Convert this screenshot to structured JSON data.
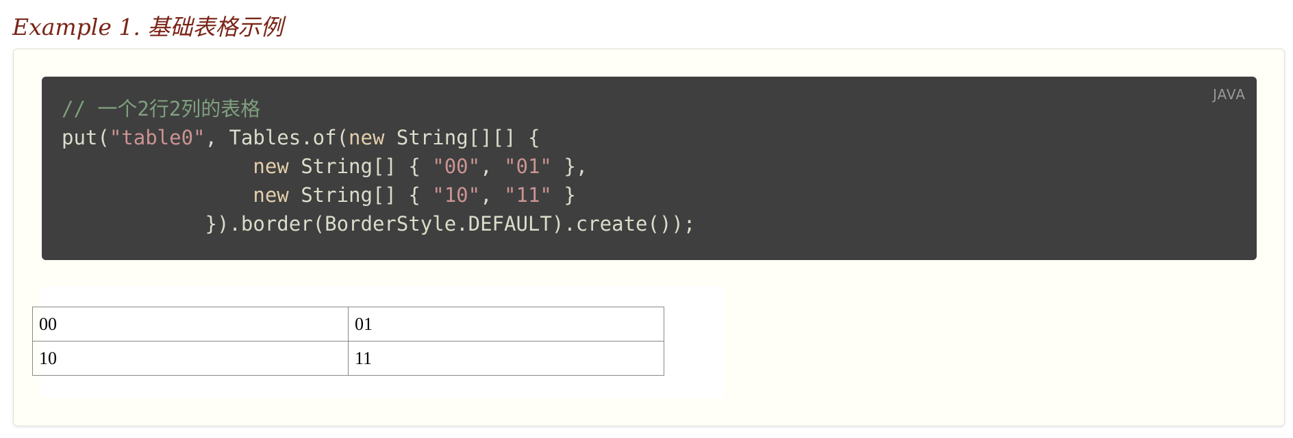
{
  "example": {
    "title": "Example 1. 基础表格示例"
  },
  "code": {
    "language": "JAVA",
    "lines": [
      [
        {
          "type": "comment",
          "text": "// 一个2行2列的表格"
        }
      ],
      [
        {
          "type": "plain",
          "text": "put("
        },
        {
          "type": "string",
          "text": "\"table0\""
        },
        {
          "type": "plain",
          "text": ", Tables.of("
        },
        {
          "type": "keyword",
          "text": "new"
        },
        {
          "type": "plain",
          "text": " String[][] {"
        }
      ],
      [
        {
          "type": "plain",
          "text": "                "
        },
        {
          "type": "keyword",
          "text": "new"
        },
        {
          "type": "plain",
          "text": " String[] { "
        },
        {
          "type": "string",
          "text": "\"00\""
        },
        {
          "type": "plain",
          "text": ", "
        },
        {
          "type": "string",
          "text": "\"01\""
        },
        {
          "type": "plain",
          "text": " },"
        }
      ],
      [
        {
          "type": "plain",
          "text": "                "
        },
        {
          "type": "keyword",
          "text": "new"
        },
        {
          "type": "plain",
          "text": " String[] { "
        },
        {
          "type": "string",
          "text": "\"10\""
        },
        {
          "type": "plain",
          "text": ", "
        },
        {
          "type": "string",
          "text": "\"11\""
        },
        {
          "type": "plain",
          "text": " }"
        }
      ],
      [
        {
          "type": "plain",
          "text": "            }).border(BorderStyle.DEFAULT).create());"
        }
      ]
    ]
  },
  "result_table": {
    "rows": [
      [
        "00",
        "01"
      ],
      [
        "10",
        "11"
      ]
    ]
  },
  "colors": {
    "title": "#7a2518",
    "code_background": "#3f3f3f",
    "comment": "#7f9f7f",
    "string": "#cc9393",
    "keyword": "#e3ceab",
    "plain": "#dcdccc"
  }
}
